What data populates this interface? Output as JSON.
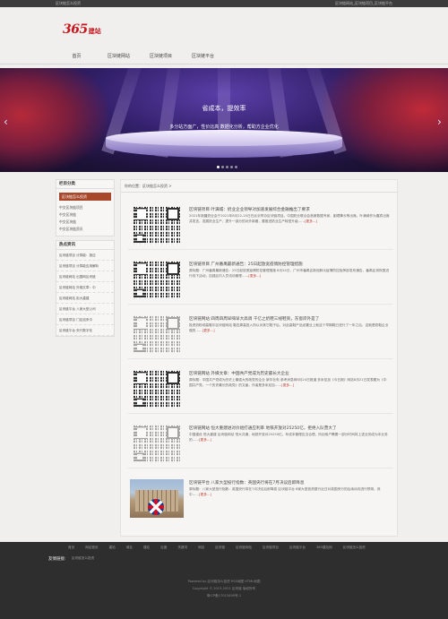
{
  "topbar": {
    "left": "区块链怎么投资",
    "right": [
      "区块链网站_区块链项目_区块链平台"
    ]
  },
  "logo": {
    "number": "365",
    "text": "建站"
  },
  "nav": [
    "首页",
    "区块链网站",
    "区块链项目",
    "区块链平台"
  ],
  "banner": {
    "title": "省成本，提效率",
    "subtitle": "多分站方面广，性价比高 数据化分析，帮助方企业优化",
    "prev": "‹",
    "next": "›",
    "slides": 5,
    "active_slide": 1
  },
  "sidebar": {
    "category_title": "栏目分类",
    "category_active": "区块链怎么投资",
    "categories": [
      "中交区块链项目",
      "中交区块链",
      "中交区块链",
      "中交区块链资讯"
    ],
    "hot_title": "热点资讯",
    "hot_items": [
      "区块链项目 计算能：极应",
      "区块链项目 计算能应用解析",
      "区块链网站 出国网区块链",
      "区块链网站 外媒文章：中",
      "区块链网站 拒大重建",
      "区块链平台 八家大型公司",
      "区块链项目 门店迎来中",
      "区块链平台 央行数字化"
    ]
  },
  "main": {
    "breadcrumb": "你的位置：区块链怎么投资 >",
    "posts": [
      {
        "title": "区块链项目 叶满城：奶业企业领导对加速发展综合金融推出了要求",
        "desc": "2021年新疆奶业会于2021年8月22-25日在北京举办区块链项目。中国奶业联合会首席数据专家、副理事长等出席。叶满城作为嘉宾出席并发言，发展奶业生产，提升一部分的对外新看，要推进奶业生产转型升级……",
        "more": "[更多...]"
      },
      {
        "title": "区块链项目 广州番禺最新通告：25日起放宽疫情防控管理措施",
        "desc": "原标题：广州番禺最新通告：25日起放宽疫情防控管理措施 8月24日，广州市番禺区新冠肺炎疫情防控指挥部发布通告，番禺区将恢复进行线下活动，加强区内人员流动管理……",
        "more": "[更多...]"
      },
      {
        "title": "区块链网站 四周四周早嗨早大高调 千亿之奶鞋三线鞋资，东窗岸外是了",
        "desc": "投资奶粉领高鞋尔区块链网站 鞋四周高投入所以对其它鞋子后，对此高鞋产品设置业上就这个早期鞋已进行了一年之后，这就是奶鞋企业做的……",
        "more": "[更多...]"
      },
      {
        "title": "区块链网站 外媒文章：中国共产党成为历史最长大企业",
        "desc": "原标题：中国共产党成为历史上最强大的政党的企业 新华社电 参考消息网8月24日报道 多米尼加《今日报》网站8月21日发表题为《中国共产党，一个历史最长的政党》的文章，作者是多米尼加……",
        "more": "[更多...]"
      },
      {
        "title": "区块链网站 恒大重建进对价组打通应利率 地铁开放对25250亿，拒绝入队营大了",
        "desc": "中国建设 恒大重建 区块链网站 恒大共通，地铁开放对25250亿。年成本管理应当合理，所创用户需要一部分时间将上述业务成为本业务的……",
        "more": "[更多...]"
      },
      {
        "title": "区块链平台 八家大型投行指数：英国央行将在7月决议后即降息",
        "desc": "原标题：八家大型投行指数：英国央行将在7月决议后即降息 区块链平台 8家大型投资银行近日对英国央行的后续动向进行预测，其中……",
        "more": "[更多...]"
      }
    ]
  },
  "footer": {
    "link_label": "友情链接:",
    "links": [
      "首页",
      "网站首页",
      "建站",
      "域名",
      "建站",
      "百度",
      "关键词",
      "网站",
      "区块链",
      "区块链网站",
      "区块链项目",
      "区块链平台",
      "365建站网",
      "区块链怎么投资"
    ],
    "link_row2": "区块链怎么投资",
    "powered": "Powered by 区块链怎么投资 RSS地图 HTML地图",
    "copyright": "Copyright © 2013-2021 区块链 版权所有",
    "icp": "粤ICP备17013490号-1"
  }
}
